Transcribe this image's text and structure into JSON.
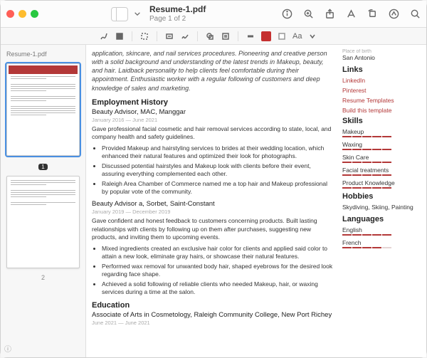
{
  "window": {
    "title": "Resume-1.pdf",
    "subtitle": "Page 1 of 2"
  },
  "sidebar": {
    "filename": "Resume-1.pdf",
    "page1_badge": "1",
    "page2_num": "2"
  },
  "resume": {
    "summary": "application, skincare, and nail services procedures. Pioneering and creative person with a solid background and understanding of the latest trends in Makeup, beauty, and hair. Laidback personality to help clients feel comfortable during their appointment. Enthusiastic worker with a regular following of customers and deep knowledge of sales and marketing.",
    "employment_heading": "Employment History",
    "job1": {
      "title": "Beauty Advisor, MAC, Manggar",
      "dates": "January 2016 — June 2021",
      "desc": "Gave professional facial cosmetic and hair removal services according to state, local, and company health and safety guidelines.",
      "bullets": [
        "Provided Makeup and hairstyling services to brides at their wedding location, which enhanced their natural features and optimized their look for photographs.",
        "Discussed potential hairstyles and Makeup look with clients before their event, assuring everything complemented each other.",
        "Raleigh Area Chamber of Commerce named me a top hair and Makeup professional by popular vote of the community."
      ]
    },
    "job2": {
      "title": "Beauty Advisor a, Sorbet, Saint-Constant",
      "dates": "January 2019 — December 2019",
      "desc": "Gave confident and honest feedback to customers concerning products. Built lasting relationships with clients by following up on them after purchases, suggesting new products, and inviting them to upcoming events.",
      "bullets": [
        "Mixed ingredients created an exclusive hair color for clients and applied said color to attain a new look, eliminate gray hairs, or showcase their natural features.",
        "Performed wax removal for unwanted body hair, shaped eyebrows for the desired look regarding face shape.",
        "Achieved a solid following of reliable clients who needed Makeup, hair, or waxing services during a time at the salon."
      ]
    },
    "education_heading": "Education",
    "edu": {
      "title": "Associate of Arts in Cosmetology, Raleigh Community College, New Port Richey",
      "dates": "June 2021 — June 2021"
    }
  },
  "side": {
    "pob_label": "Place of birth",
    "pob": "San Antonio",
    "links_heading": "Links",
    "links": [
      "LinkedIn",
      "Pinterest",
      "Resume Templates",
      "Build this template"
    ],
    "skills_heading": "Skills",
    "skills": [
      {
        "name": "Makeup",
        "level": 5
      },
      {
        "name": "Waxing",
        "level": 5
      },
      {
        "name": "Skin Care",
        "level": 5
      },
      {
        "name": "Facial treatments",
        "level": 5
      },
      {
        "name": "Product Knowledge",
        "level": 5
      }
    ],
    "hobbies_heading": "Hobbies",
    "hobbies": "Skydiving, Skiing, Painting",
    "languages_heading": "Languages",
    "languages": [
      {
        "name": "English",
        "level": 5
      },
      {
        "name": "French",
        "level": 4
      }
    ]
  }
}
